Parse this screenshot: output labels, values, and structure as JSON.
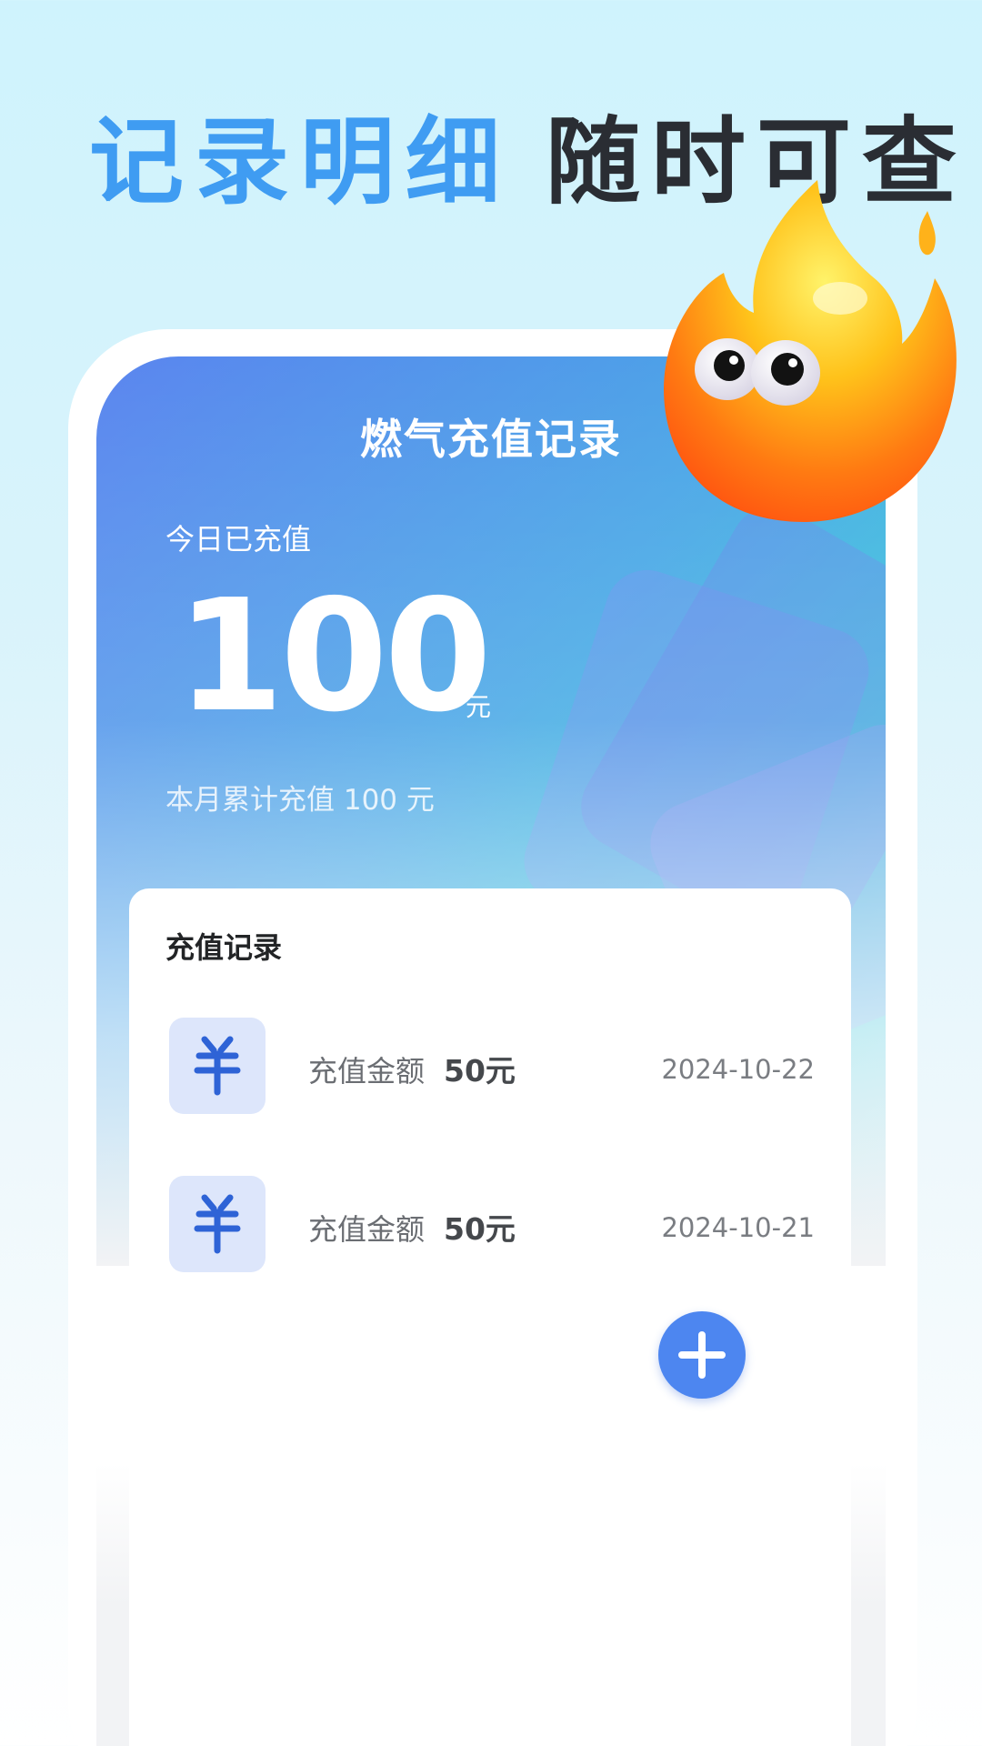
{
  "headline": {
    "part1": "记录明细",
    "part2": "随时可查"
  },
  "screen": {
    "title": "燃气充值记录",
    "today_label": "今日已充值",
    "today_amount": "100",
    "today_unit": "元",
    "month_summary": "本月累计充值 100 元"
  },
  "records": {
    "title": "充值记录",
    "items": [
      {
        "label": "充值金额",
        "amount": "50元",
        "date": "2024-10-22",
        "icon": "yuan-icon"
      },
      {
        "label": "充值金额",
        "amount": "50元",
        "date": "2024-10-21",
        "icon": "yuan-icon"
      }
    ]
  },
  "fab": {
    "icon": "plus-icon"
  },
  "mascot": {
    "icon": "flame-mascot"
  },
  "colors": {
    "accent": "#3f9cf2",
    "dark_text": "#2a2d33",
    "fab": "#4d86f0",
    "icon_bg": "#dde6fb",
    "icon_fg": "#2e63d6"
  }
}
